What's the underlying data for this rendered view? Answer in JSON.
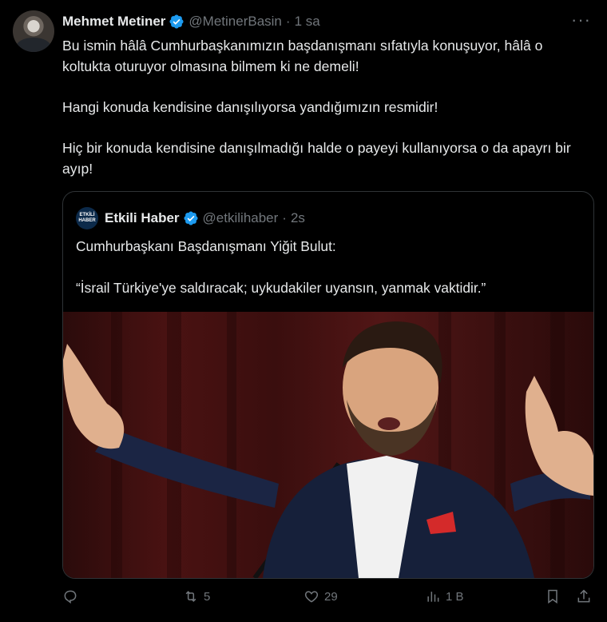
{
  "tweet": {
    "author_name": "Mehmet Metiner",
    "author_handle": "@MetinerBasin",
    "time": "1 sa",
    "more_icon": "more-dots-icon",
    "paragraphs": [
      "Bu ismin hâlâ Cumhurbaşkanımızın başdanışmanı sıfatıyla konuşuyor, hâlâ o koltukta oturuyor olmasına bilmem ki ne demeli!",
      "Hangi konuda kendisine danışılıyorsa yandığımızın resmidir!",
      "Hiç bir konuda kendisine danışılmadığı halde o payeyi kullanıyorsa o da apayrı bir ayıp!"
    ]
  },
  "quote": {
    "avatar_text_1": "ETKİLİ",
    "avatar_text_2": "HABER",
    "author_name": "Etkili Haber",
    "author_handle": "@etkilihaber",
    "time": "2s",
    "line1": "Cumhurbaşkanı Başdanışmanı Yiğit Bulut:",
    "line2": "“İsrail Türkiye'ye saldıracak; uykudakiler uyansın, yanmak vaktidir.”"
  },
  "actions": {
    "reply_count": "",
    "retweet_count": "5",
    "like_count": "29",
    "views_count": "1 B"
  },
  "colors": {
    "background": "#000000",
    "text": "#e7e9ea",
    "muted": "#71767b",
    "verified": "#1d9bf0",
    "border": "#2f3336"
  }
}
